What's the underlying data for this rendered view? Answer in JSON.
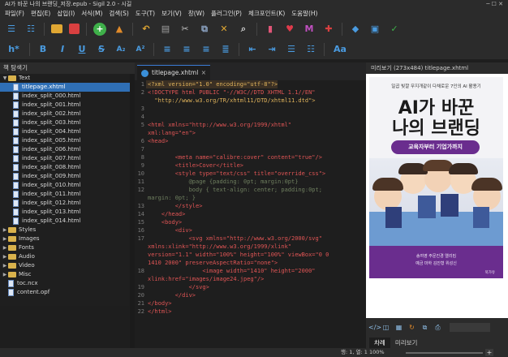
{
  "window": {
    "title": "AI가 바꾼 나의 브랜딩_저장.epub - Sigil 2.0 - 시길"
  },
  "menu": [
    "파일(F)",
    "편집(E)",
    "삽입(I)",
    "서식(M)",
    "검색(S)",
    "도구(T)",
    "보기(V)",
    "창(W)",
    "플러그인(P)",
    "체크포인트(K)",
    "도움말(H)"
  ],
  "toolbar2": {
    "bold": "B",
    "italic": "I",
    "underline": "U",
    "strike": "S",
    "sub": "A₂",
    "sup": "A²",
    "heading": "h*",
    "text_style": "Aa"
  },
  "book_browser": {
    "title": "책 탐색기",
    "items": [
      {
        "label": "Text",
        "type": "folder",
        "open": true
      },
      {
        "label": "titlepage.xhtml",
        "type": "file",
        "selected": true
      },
      {
        "label": "index_split_000.html",
        "type": "file"
      },
      {
        "label": "index_split_001.html",
        "type": "file"
      },
      {
        "label": "index_split_002.html",
        "type": "file"
      },
      {
        "label": "index_split_003.html",
        "type": "file"
      },
      {
        "label": "index_split_004.html",
        "type": "file"
      },
      {
        "label": "index_split_005.html",
        "type": "file"
      },
      {
        "label": "index_split_006.html",
        "type": "file"
      },
      {
        "label": "index_split_007.html",
        "type": "file"
      },
      {
        "label": "index_split_008.html",
        "type": "file"
      },
      {
        "label": "index_split_009.html",
        "type": "file"
      },
      {
        "label": "index_split_010.html",
        "type": "file"
      },
      {
        "label": "index_split_011.html",
        "type": "file"
      },
      {
        "label": "index_split_012.html",
        "type": "file"
      },
      {
        "label": "index_split_013.html",
        "type": "file"
      },
      {
        "label": "index_split_014.html",
        "type": "file"
      },
      {
        "label": "Styles",
        "type": "folder"
      },
      {
        "label": "Images",
        "type": "folder"
      },
      {
        "label": "Fonts",
        "type": "folder"
      },
      {
        "label": "Audio",
        "type": "folder"
      },
      {
        "label": "Video",
        "type": "folder"
      },
      {
        "label": "Misc",
        "type": "folder"
      },
      {
        "label": "toc.ncx",
        "type": "file"
      },
      {
        "label": "content.opf",
        "type": "file"
      }
    ]
  },
  "editor": {
    "tab_label": "titlepage.xhtml",
    "lines": [
      {
        "n": "1",
        "cls": "c-str",
        "text": "<?xml version=\"1.0\" encoding=\"utf-8\"?>",
        "current": true
      },
      {
        "n": "2",
        "cls": "c-tag",
        "text": "<!DOCTYPE html PUBLIC \"-//W3C//DTD XHTML 1.1//EN\""
      },
      {
        "n": "",
        "cls": "c-str",
        "text": "  \"http://www.w3.org/TR/xhtml11/DTD/xhtml11.dtd\">"
      },
      {
        "n": "3",
        "cls": "c-pl",
        "text": ""
      },
      {
        "n": "4",
        "cls": "c-pl",
        "text": ""
      },
      {
        "n": "5",
        "cls": "c-tag",
        "text": "<html xmlns=\"http://www.w3.org/1999/xhtml\""
      },
      {
        "n": "",
        "cls": "c-tag",
        "text": "xml:lang=\"en\">"
      },
      {
        "n": "6",
        "cls": "c-tag",
        "text": "<head>"
      },
      {
        "n": "7",
        "cls": "c-pl",
        "text": ""
      },
      {
        "n": "8",
        "cls": "c-tag",
        "text": "        <meta name=\"calibre:cover\" content=\"true\"/>"
      },
      {
        "n": "9",
        "cls": "c-tag",
        "text": "        <title>Cover</title>"
      },
      {
        "n": "10",
        "cls": "c-tag",
        "text": "        <style type=\"text/css\" title=\"override_css\">"
      },
      {
        "n": "11",
        "cls": "c-com",
        "text": "            @page {padding: 0pt; margin:0pt}"
      },
      {
        "n": "12",
        "cls": "c-com",
        "text": "            body { text-align: center; padding:0pt;"
      },
      {
        "n": "",
        "cls": "c-com",
        "text": "margin: 0pt; }"
      },
      {
        "n": "13",
        "cls": "c-tag",
        "text": "        </style>"
      },
      {
        "n": "14",
        "cls": "c-tag",
        "text": "    </head>"
      },
      {
        "n": "15",
        "cls": "c-tag",
        "text": "    <body>"
      },
      {
        "n": "16",
        "cls": "c-tag",
        "text": "        <div>"
      },
      {
        "n": "17",
        "cls": "c-tag",
        "text": "            <svg xmlns=\"http://www.w3.org/2000/svg\""
      },
      {
        "n": "",
        "cls": "c-tag",
        "text": "xmlns:xlink=\"http://www.w3.org/1999/xlink\""
      },
      {
        "n": "",
        "cls": "c-tag",
        "text": "version=\"1.1\" width=\"100%\" height=\"100%\" viewBox=\"0 0"
      },
      {
        "n": "",
        "cls": "c-tag",
        "text": "1410 2000\" preserveAspectRatio=\"none\">"
      },
      {
        "n": "18",
        "cls": "c-tag",
        "text": "                <image width=\"1410\" height=\"2000\""
      },
      {
        "n": "",
        "cls": "c-tag",
        "text": "xlink:href=\"images/image24.jpeg\"/>"
      },
      {
        "n": "19",
        "cls": "c-tag",
        "text": "            </svg>"
      },
      {
        "n": "20",
        "cls": "c-tag",
        "text": "        </div>"
      },
      {
        "n": "21",
        "cls": "c-tag",
        "text": "</body>"
      },
      {
        "n": "22",
        "cls": "c-tag",
        "text": "</html>"
      }
    ]
  },
  "preview": {
    "header": "미리보기 (273x484) titlepage.xhtml",
    "cover": {
      "subtitle": "일곱 빛깔 무지개같이 다채로운 7인의 AI 활용기",
      "title_line1": "AI가 바꾼",
      "title_line2": "나의 브랜딩",
      "badge": "교육자부터 기업가까지",
      "authors_line1": "송여영 주문진경 엘리킴",
      "authors_line2": "예금 마하 김진형 위성신",
      "publisher": "북가유"
    }
  },
  "bottom_tabs": [
    "차례",
    "미리보기"
  ],
  "status": {
    "position": "행: 1, 열: 1",
    "zoom": "100%"
  }
}
